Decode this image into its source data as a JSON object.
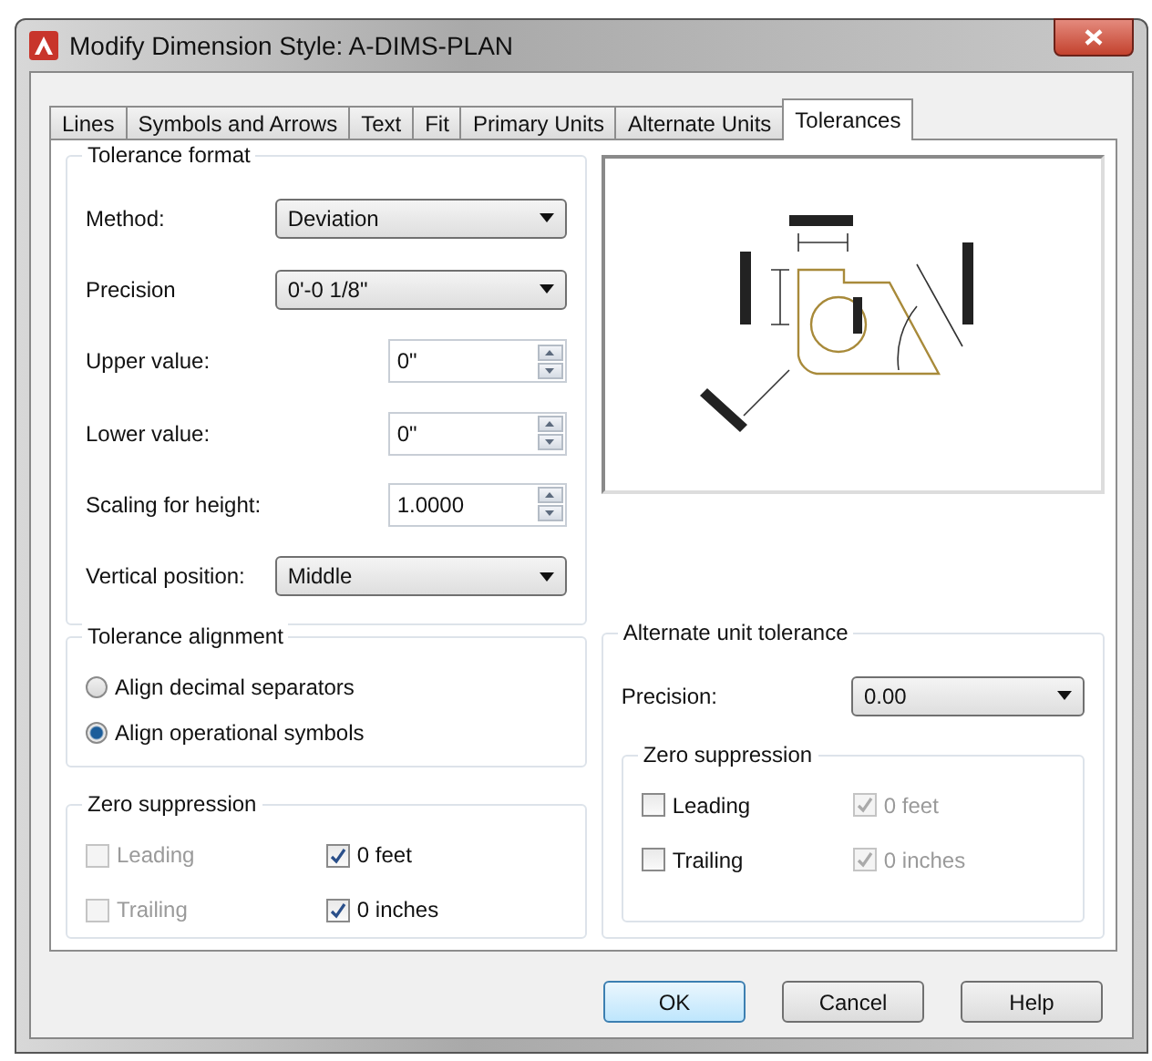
{
  "window": {
    "title": "Modify Dimension Style: A-DIMS-PLAN"
  },
  "tabs": [
    {
      "label": "Lines",
      "selected": false
    },
    {
      "label": "Symbols and Arrows",
      "selected": false
    },
    {
      "label": "Text",
      "selected": false
    },
    {
      "label": "Fit",
      "selected": false
    },
    {
      "label": "Primary Units",
      "selected": false
    },
    {
      "label": "Alternate Units",
      "selected": false
    },
    {
      "label": "Tolerances",
      "selected": true
    }
  ],
  "tolerance_format": {
    "title": "Tolerance format",
    "fields": [
      {
        "kind": "dropdown",
        "label": "Method:",
        "value": "Deviation"
      },
      {
        "kind": "dropdown",
        "label": "Precision",
        "value": "0'-0 1/8\""
      },
      {
        "kind": "spinner",
        "label": "Upper value:",
        "value": "0\""
      },
      {
        "kind": "spinner",
        "label": "Lower value:",
        "value": "0\""
      },
      {
        "kind": "spinner",
        "label": "Scaling for height:",
        "value": "1.0000"
      },
      {
        "kind": "dropdown",
        "label": "Vertical position:",
        "value": "Middle"
      }
    ]
  },
  "tolerance_alignment": {
    "title": "Tolerance alignment",
    "options": [
      {
        "label": "Align decimal separators",
        "selected": false
      },
      {
        "label": "Align operational symbols",
        "selected": true
      }
    ]
  },
  "zero_suppression": {
    "title": "Zero suppression",
    "items": [
      {
        "label": "Leading",
        "checked": false,
        "disabled": true
      },
      {
        "label": "0 feet",
        "checked": true,
        "disabled": false
      },
      {
        "label": "Trailing",
        "checked": false,
        "disabled": true
      },
      {
        "label": "0 inches",
        "checked": true,
        "disabled": false
      }
    ]
  },
  "alternate_unit_tolerance": {
    "title": "Alternate unit tolerance",
    "precision": {
      "label": "Precision:",
      "value": "0.00"
    },
    "zero_suppression": {
      "title": "Zero suppression",
      "items": [
        {
          "label": "Leading",
          "checked": false,
          "disabled": false
        },
        {
          "label": "0 feet",
          "checked": true,
          "disabled": true
        },
        {
          "label": "Trailing",
          "checked": false,
          "disabled": false
        },
        {
          "label": "0 inches",
          "checked": true,
          "disabled": true
        }
      ]
    }
  },
  "buttons": [
    {
      "label": "OK",
      "default": true
    },
    {
      "label": "Cancel",
      "default": false
    },
    {
      "label": "Help",
      "default": false
    }
  ]
}
